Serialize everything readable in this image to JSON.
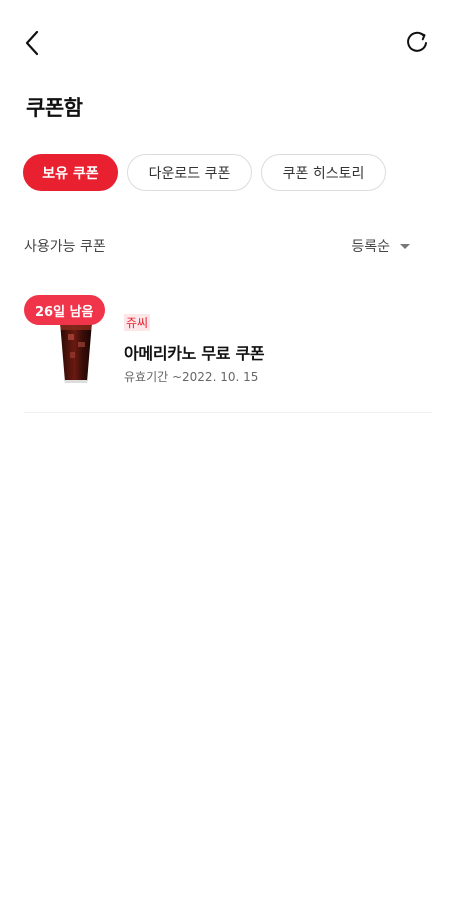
{
  "header": {
    "back_icon": "chevron-left-icon",
    "refresh_icon": "refresh-icon",
    "title": "쿠폰함"
  },
  "tabs": [
    {
      "label": "보유 쿠폰",
      "active": true
    },
    {
      "label": "다운로드 쿠폰",
      "active": false
    },
    {
      "label": "쿠폰 히스토리",
      "active": false
    }
  ],
  "list": {
    "label": "사용가능 쿠폰",
    "sort_label": "등록순",
    "sort_icon": "caret-down-icon"
  },
  "coupons": [
    {
      "days_left": "26일 남음",
      "brand": "쥬씨",
      "name": "아메리카노 무료 쿠폰",
      "expiry": "유효기간 ~2022. 10. 15",
      "image": "iced-americano-cup"
    }
  ],
  "colors": {
    "accent": "#e8202f",
    "badge": "#f0344a"
  }
}
